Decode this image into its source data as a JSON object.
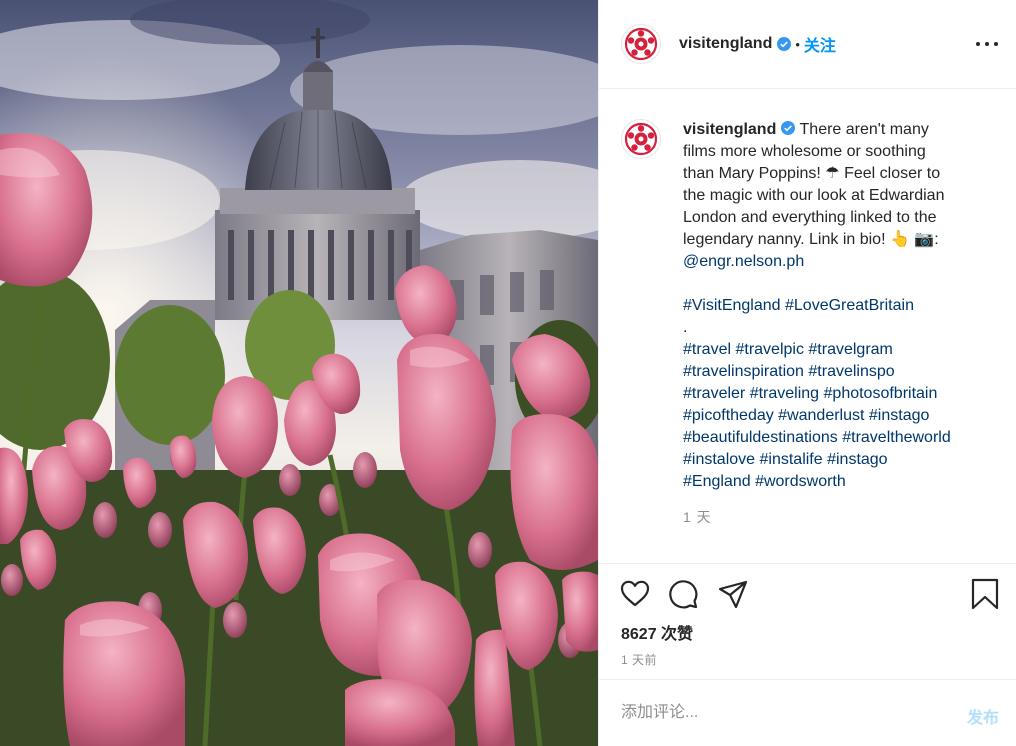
{
  "post": {
    "username": "visitengland",
    "follow_label": "关注",
    "separator": "•",
    "caption": {
      "username": "visitengland",
      "text_lines": [
        "There aren't many",
        "films more wholesome or soothing",
        "than Mary Poppins! ☂ Feel closer to",
        "the magic with our look at Edwardian",
        "London and everything linked to the",
        "legendary nanny. Link in bio! 👆 📷:"
      ],
      "mention": "@engr.nelson.ph",
      "hashtags_primary": "#VisitEngland #LoveGreatBritain",
      "dot": ".",
      "hashtag_lines": [
        "#travel #travelpic #travelgram",
        "#travelinspiration #travelinspo",
        "#traveler #traveling #photosofbritain",
        "#picoftheday #wanderlust #instago",
        "#beautifuldestinations #traveltheworld",
        "#instalove #instalife #instago",
        "#England #wordsworth"
      ],
      "time_relative": "1 天"
    },
    "likes": "8627 次赞",
    "posted": "1 天前",
    "comment_placeholder": "添加评论...",
    "publish_label": "发布"
  },
  "colors": {
    "link": "#00376b",
    "follow": "#0095f6",
    "publish_disabled": "#b2dffc",
    "verified": "#3897f0",
    "logo_red": "#d4213d"
  },
  "icons": {
    "more": "more-options-icon",
    "like": "heart-icon",
    "comment": "comment-icon",
    "share": "paper-plane-icon",
    "save": "bookmark-icon",
    "verified": "verified-badge-icon",
    "logo": "rose-logo-icon"
  }
}
